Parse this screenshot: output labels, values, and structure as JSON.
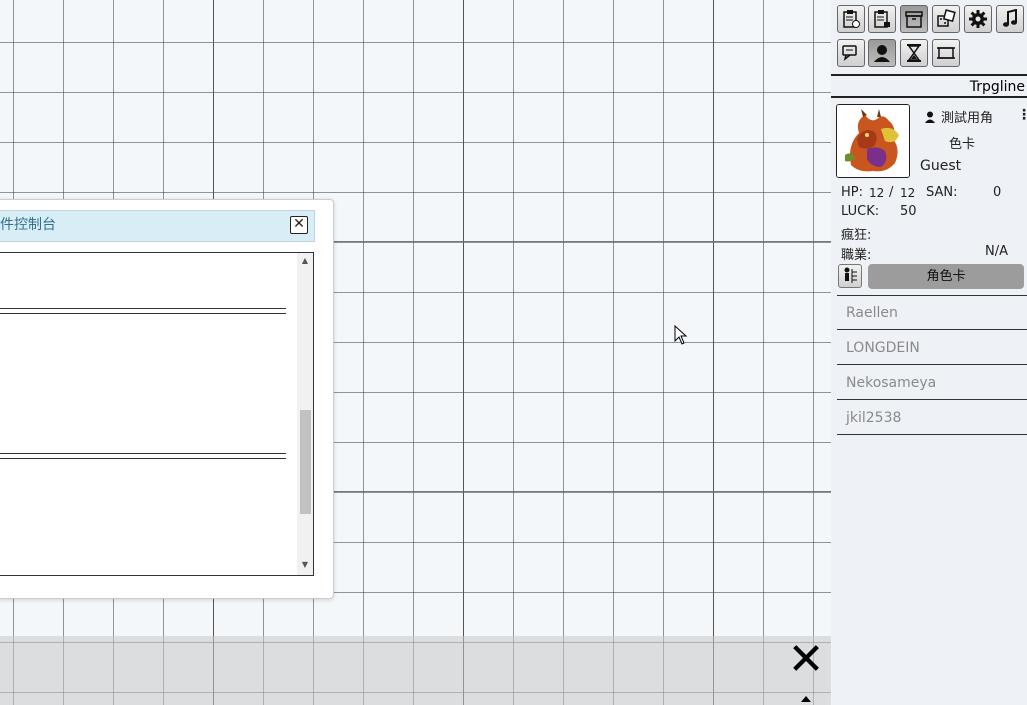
{
  "console": {
    "title": "件控制台",
    "close_label": "✕"
  },
  "toolbar": {
    "row1": [
      "clipboard-check-icon",
      "clipboard-lock-icon",
      "box-icon",
      "dice-icon",
      "gear-icon",
      "music-note-icon"
    ],
    "row2": [
      "chat-bubbles-icon",
      "character-icon",
      "hourglass-icon",
      "map-scroll-icon"
    ],
    "active": [
      "box-icon",
      "character-icon"
    ]
  },
  "sidebar": {
    "app_name": "Trpgline",
    "character": {
      "name_line1": "測試用角",
      "name_line2": "色卡",
      "menu_glyph": "⋮",
      "owner": "Guest",
      "hp_label": "HP:",
      "hp_current": "12",
      "hp_sep": "/",
      "hp_max": "12",
      "san_label": "SAN:",
      "san_value": "0",
      "luck_label": "LUCK:",
      "luck_value": "50",
      "madness_label": "瘋狂:",
      "job_label": "職業:",
      "job_value": "N/A",
      "sheet_button": "角色卡"
    },
    "players": [
      "Raellen",
      "LONGDEIN",
      "Nekosameya",
      "jkil2538"
    ]
  },
  "map": {
    "close_glyph": "✕"
  }
}
